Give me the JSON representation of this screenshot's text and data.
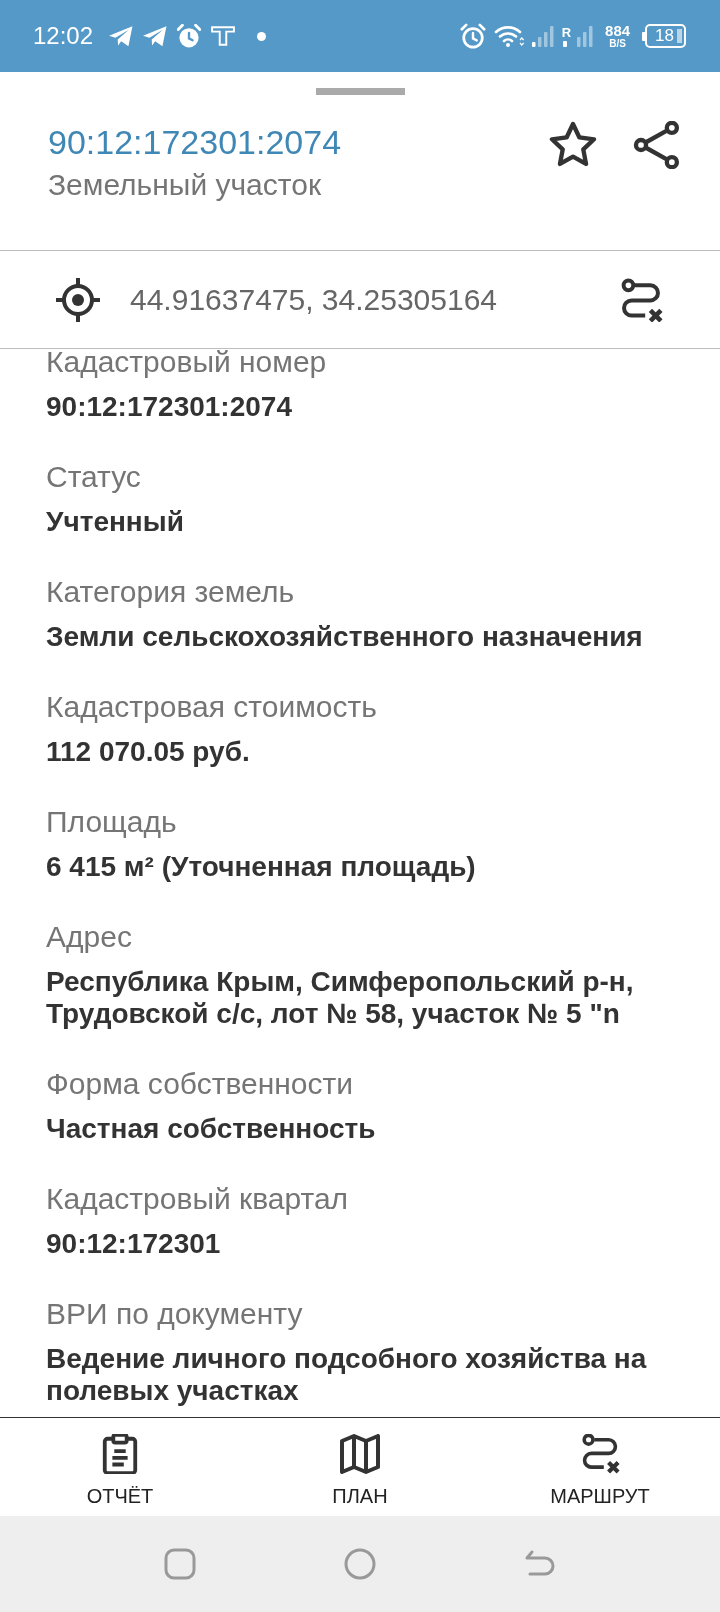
{
  "status_bar": {
    "time": "12:02",
    "roaming": "R",
    "net_speed": "884",
    "net_speed_unit": "B/S",
    "battery": "18"
  },
  "sheet": {
    "title": "90:12:172301:2074",
    "subtitle": "Земельный участок"
  },
  "coordinates": {
    "text": "44.91637475, 34.25305164"
  },
  "fields": [
    {
      "label": "Кадастровый номер",
      "value": "90:12:172301:2074"
    },
    {
      "label": "Статус",
      "value": "Учтенный"
    },
    {
      "label": "Категория земель",
      "value": "Земли сельскохозяйственного назначения"
    },
    {
      "label": "Кадастровая стоимость",
      "value": "112 070.05 руб."
    },
    {
      "label": "Площадь",
      "value": "6 415 м² (Уточненная площадь)"
    },
    {
      "label": "Адрес",
      "value": "Республика Крым, Симферопольский р-н, Трудовской с/с, лот № 58, участок № 5 \"n"
    },
    {
      "label": "Форма собственности",
      "value": "Частная собственность"
    },
    {
      "label": "Кадастровый квартал",
      "value": "90:12:172301"
    },
    {
      "label": "ВРИ по документу",
      "value": "Ведение личного подсобного хозяйства на полевых участках"
    }
  ],
  "bottom_nav": [
    {
      "kind": "report",
      "label": "ОТЧЁТ"
    },
    {
      "kind": "plan",
      "label": "ПЛАН"
    },
    {
      "kind": "route",
      "label": "МАРШРУТ"
    }
  ]
}
